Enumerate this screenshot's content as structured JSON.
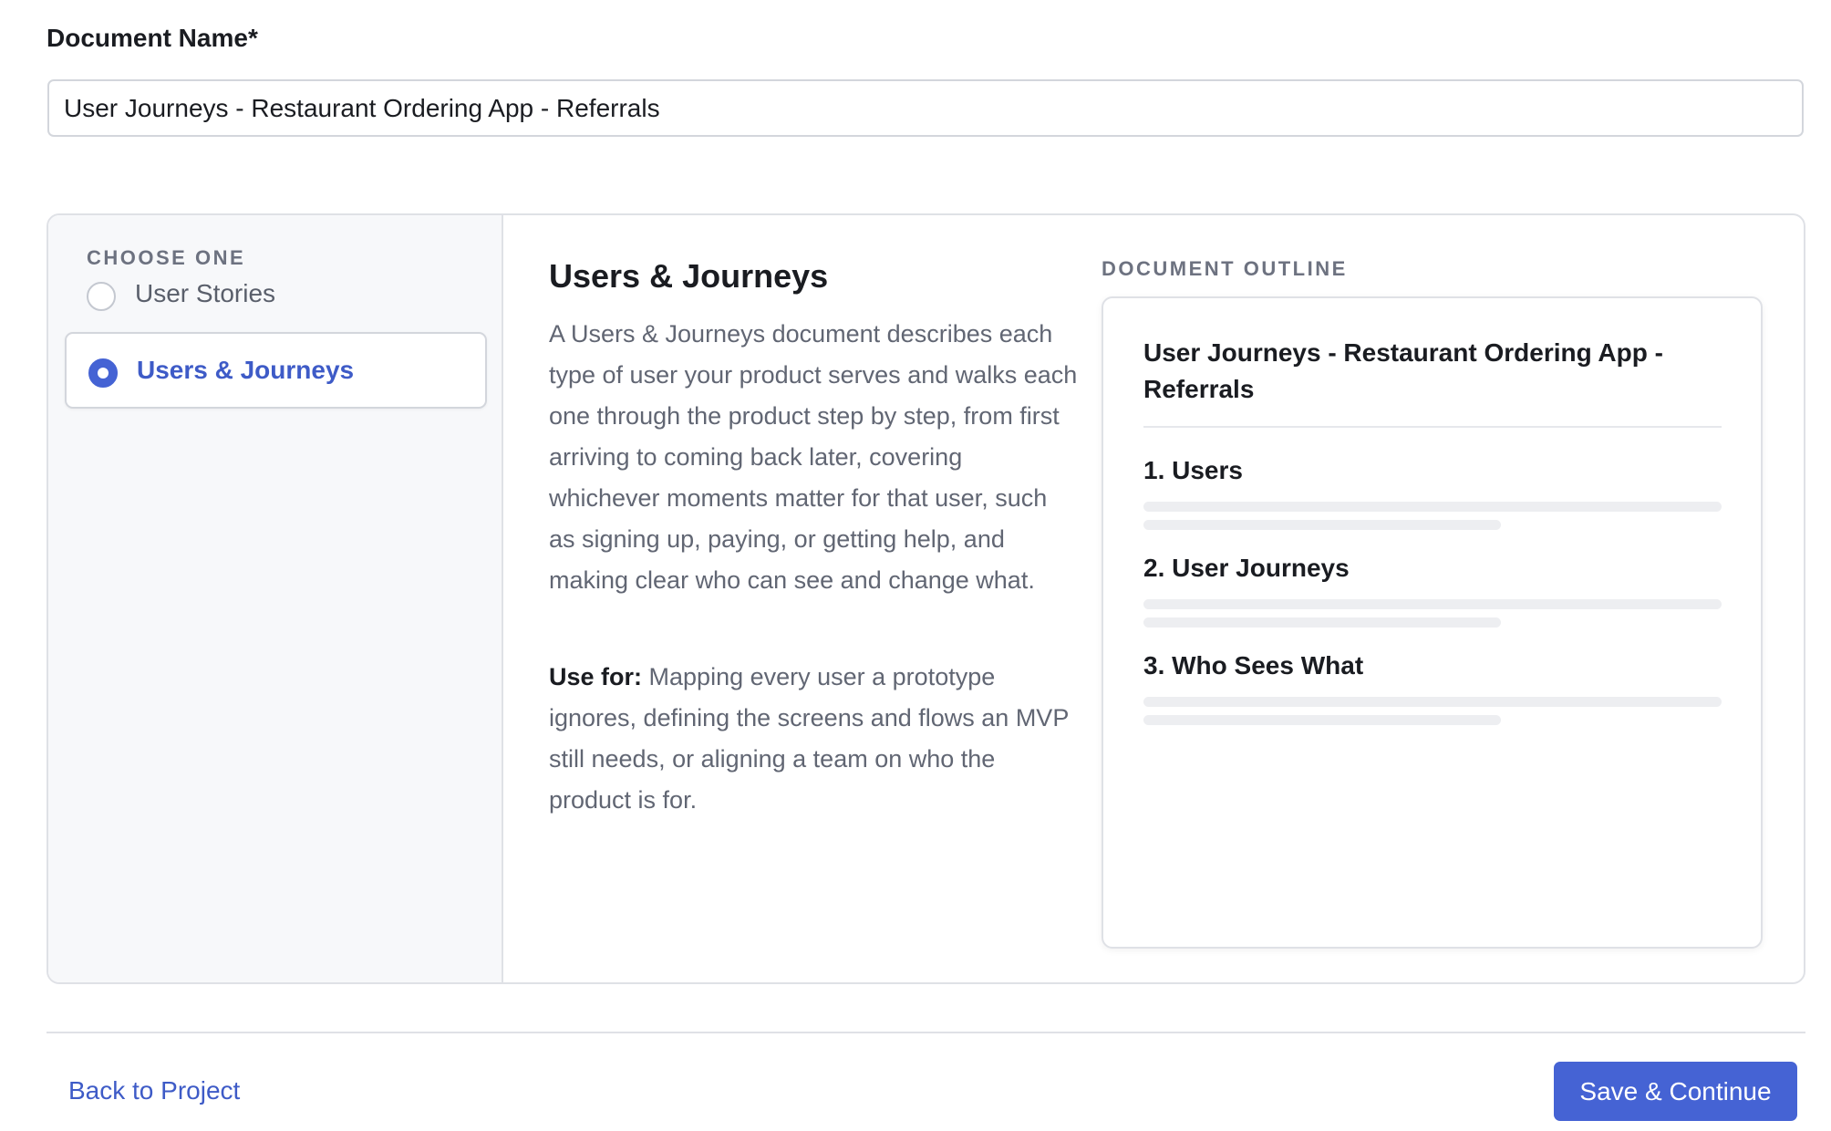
{
  "document_name": {
    "label": "Document Name*",
    "value": "User Journeys - Restaurant Ordering App - Referrals"
  },
  "chooser": {
    "heading": "CHOOSE ONE",
    "options": [
      {
        "label": "User Stories",
        "selected": false
      },
      {
        "label": "Users & Journeys",
        "selected": true
      }
    ]
  },
  "detail": {
    "title": "Users & Journeys",
    "description": "A Users & Journeys document describes each type of user your product serves and walks each one through the product step by step, from first arriving to coming back later, covering whichever moments matter for that user, such as signing up, paying, or getting help, and making clear who can see and change what.",
    "use_for_label": "Use for:",
    "use_for_text": "Mapping every user a prototype ignores, defining the screens and flows an MVP still needs, or aligning a team on who the product is for."
  },
  "outline": {
    "heading": "DOCUMENT OUTLINE",
    "doc_title": "User Journeys - Restaurant Ordering App - Referrals",
    "sections": [
      {
        "title": "1. Users"
      },
      {
        "title": "2. User Journeys"
      },
      {
        "title": "3. Who Sees What"
      }
    ]
  },
  "footer": {
    "back_label": "Back to Project",
    "save_label": "Save & Continue"
  },
  "colors": {
    "accent": "#4563d4",
    "link": "#3e5bc7",
    "sidebar_bg": "#f7f8fa",
    "border": "#dfe1e6"
  }
}
